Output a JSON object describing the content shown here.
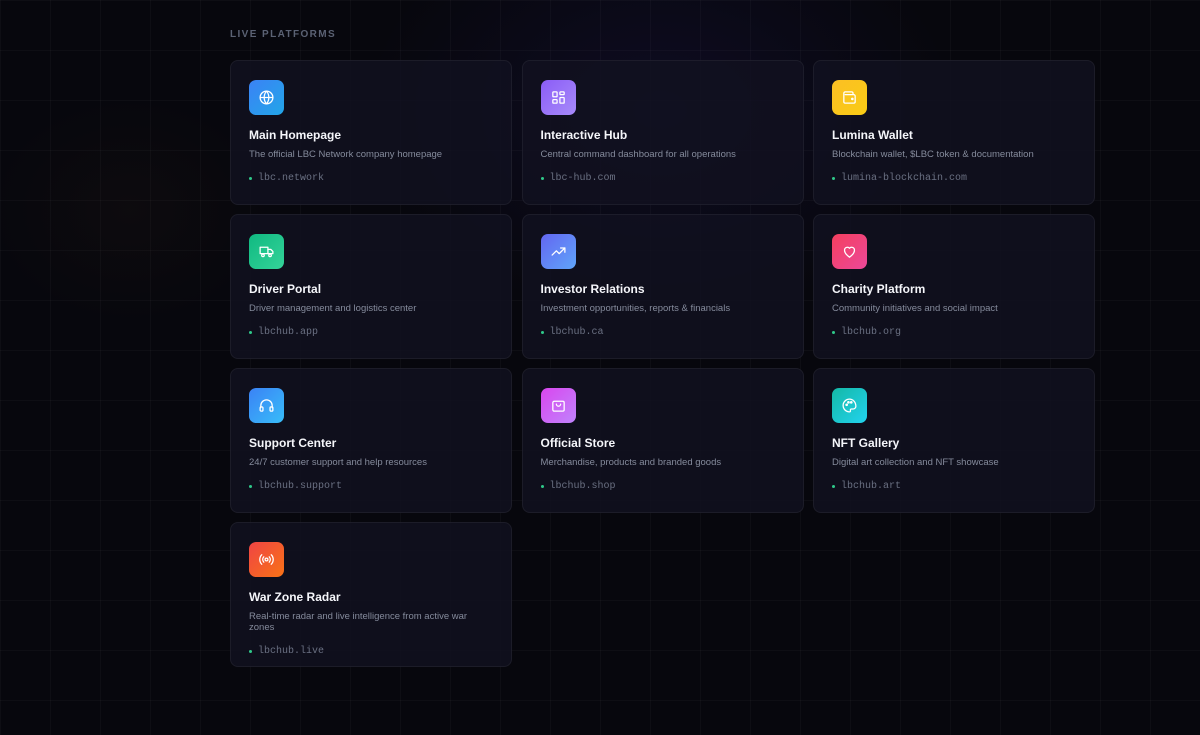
{
  "section": {
    "title": "LIVE PLATFORMS"
  },
  "platforms": [
    {
      "title": "Main Homepage",
      "description": "The official LBC Network company homepage",
      "url": "lbc.network",
      "icon": "globe-icon",
      "color_from": "#3b82f6",
      "color_to": "#22a6e8"
    },
    {
      "title": "Interactive Hub",
      "description": "Central command dashboard for all operations",
      "url": "lbc-hub.com",
      "icon": "grid-icon",
      "color_from": "#8b5cf6",
      "color_to": "#a78bfa"
    },
    {
      "title": "Lumina Wallet",
      "description": "Blockchain wallet, $LBC token & documentation",
      "url": "lumina-blockchain.com",
      "icon": "wallet-icon",
      "color_from": "#fbbf24",
      "color_to": "#facc15"
    },
    {
      "title": "Driver Portal",
      "description": "Driver management and logistics center",
      "url": "lbchub.app",
      "icon": "truck-icon",
      "color_from": "#10b981",
      "color_to": "#34d399"
    },
    {
      "title": "Investor Relations",
      "description": "Investment opportunities, reports & financials",
      "url": "lbchub.ca",
      "icon": "trending-up-icon",
      "color_from": "#6366f1",
      "color_to": "#60a5fa"
    },
    {
      "title": "Charity Platform",
      "description": "Community initiatives and social impact",
      "url": "lbchub.org",
      "icon": "heart-icon",
      "color_from": "#f43f5e",
      "color_to": "#ec4899"
    },
    {
      "title": "Support Center",
      "description": "24/7 customer support and help resources",
      "url": "lbchub.support",
      "icon": "headphones-icon",
      "color_from": "#3b82f6",
      "color_to": "#38bdf8"
    },
    {
      "title": "Official Store",
      "description": "Merchandise, products and branded goods",
      "url": "lbchub.shop",
      "icon": "shopping-bag-icon",
      "color_from": "#d946ef",
      "color_to": "#c084fc"
    },
    {
      "title": "NFT Gallery",
      "description": "Digital art collection and NFT showcase",
      "url": "lbchub.art",
      "icon": "palette-icon",
      "color_from": "#14b8a6",
      "color_to": "#22d3ee"
    },
    {
      "title": "War Zone Radar",
      "description": "Real-time radar and live intelligence from active war zones",
      "url": "lbchub.live",
      "icon": "radio-icon",
      "color_from": "#ef4444",
      "color_to": "#f97316"
    }
  ],
  "status_color": "#2fc98a"
}
